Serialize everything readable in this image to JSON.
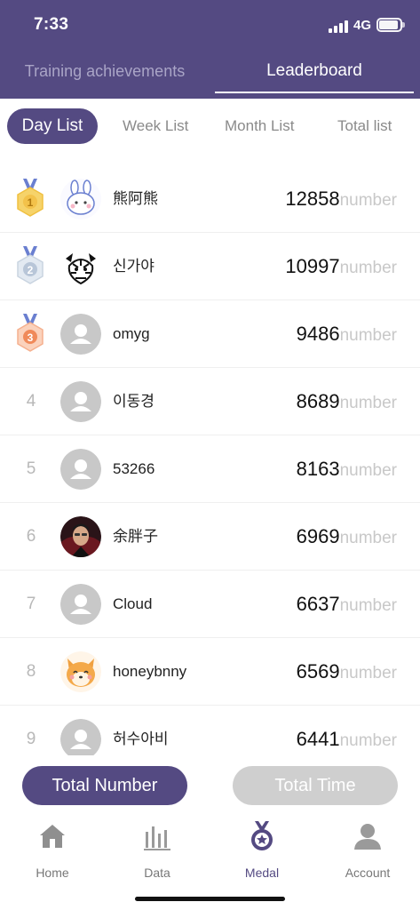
{
  "status_bar": {
    "time": "7:33",
    "network": "4G"
  },
  "main_tabs": [
    {
      "label": "Training achievements",
      "active": false
    },
    {
      "label": "Leaderboard",
      "active": true
    }
  ],
  "sub_tabs": [
    {
      "label": "Day List",
      "active": true
    },
    {
      "label": "Week List",
      "active": false
    },
    {
      "label": "Month List",
      "active": false
    },
    {
      "label": "Total list",
      "active": false
    }
  ],
  "leaderboard": {
    "unit": "number",
    "entries": [
      {
        "rank": "1",
        "name": "熊阿熊",
        "score": "12858",
        "avatar": "bunny-avatar"
      },
      {
        "rank": "2",
        "name": "신가야",
        "score": "10997",
        "avatar": "tiger-avatar"
      },
      {
        "rank": "3",
        "name": "omyg",
        "score": "9486",
        "avatar": "default-avatar"
      },
      {
        "rank": "4",
        "name": "이동경",
        "score": "8689",
        "avatar": "default-avatar"
      },
      {
        "rank": "5",
        "name": "53266",
        "score": "8163",
        "avatar": "default-avatar"
      },
      {
        "rank": "6",
        "name": "余胖子",
        "score": "6969",
        "avatar": "photo-avatar"
      },
      {
        "rank": "7",
        "name": "Cloud",
        "score": "6637",
        "avatar": "default-avatar"
      },
      {
        "rank": "8",
        "name": "honeybnny",
        "score": "6569",
        "avatar": "shiba-avatar"
      },
      {
        "rank": "9",
        "name": "허수아비",
        "score": "6441",
        "avatar": "default-avatar"
      }
    ]
  },
  "actions": {
    "total_number": "Total Number",
    "total_time": "Total Time"
  },
  "tabbar": [
    {
      "label": "Home",
      "icon": "home-icon",
      "active": false
    },
    {
      "label": "Data",
      "icon": "bar-chart-icon",
      "active": false
    },
    {
      "label": "Medal",
      "icon": "medal-icon",
      "active": true
    },
    {
      "label": "Account",
      "icon": "person-icon",
      "active": false
    }
  ],
  "colors": {
    "brand": "#544a82",
    "gold": "#f3c24a",
    "silver": "#c9d4e0",
    "bronze": "#f08a5a",
    "muted": "#c8c8c8"
  }
}
